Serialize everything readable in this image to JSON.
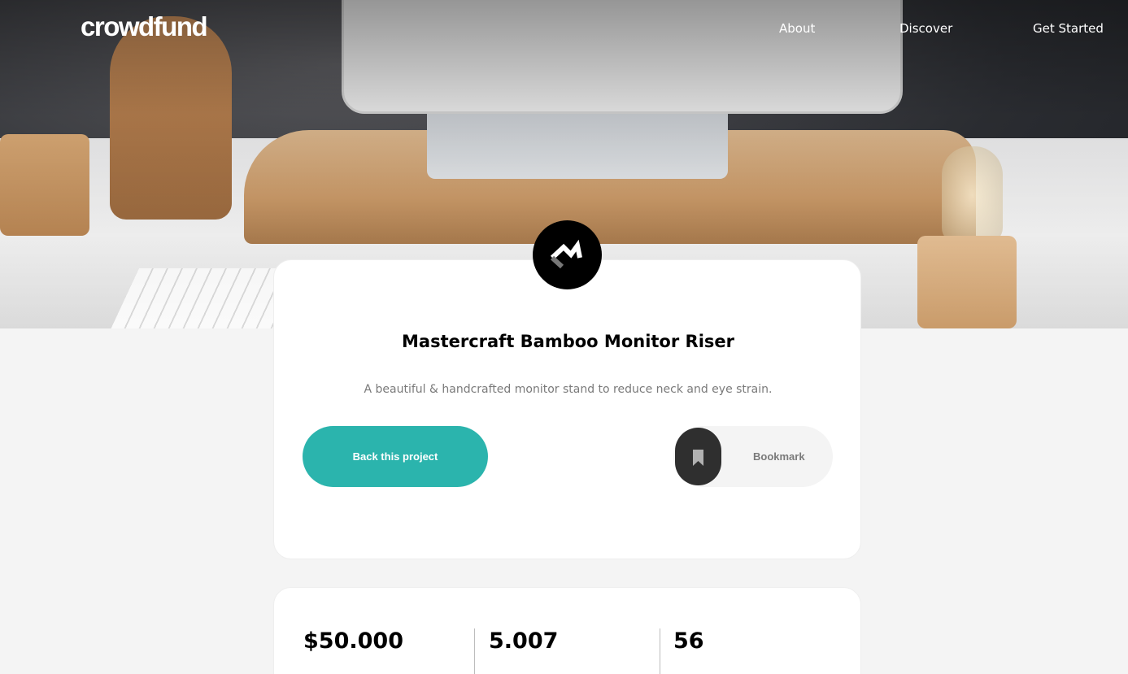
{
  "header": {
    "logo": "crowdfund",
    "nav": [
      {
        "label": "About"
      },
      {
        "label": "Discover"
      },
      {
        "label": "Get Started"
      }
    ]
  },
  "project": {
    "title": "Mastercraft Bamboo Monitor Riser",
    "description": "A beautiful & handcrafted monitor stand to reduce neck and eye strain.",
    "back_label": "Back this project",
    "bookmark_label": "Bookmark",
    "icons": {
      "brand": "mastercraft-logo-icon",
      "bookmark": "bookmark-icon"
    }
  },
  "stats": {
    "backed_amount": "$50.000",
    "total_backers": "5.007",
    "days_left": "56"
  },
  "colors": {
    "accent": "#2bb4ad",
    "dark": "#2f2f2f",
    "background": "#f4f4f4",
    "muted_text": "#7a7a7a"
  }
}
